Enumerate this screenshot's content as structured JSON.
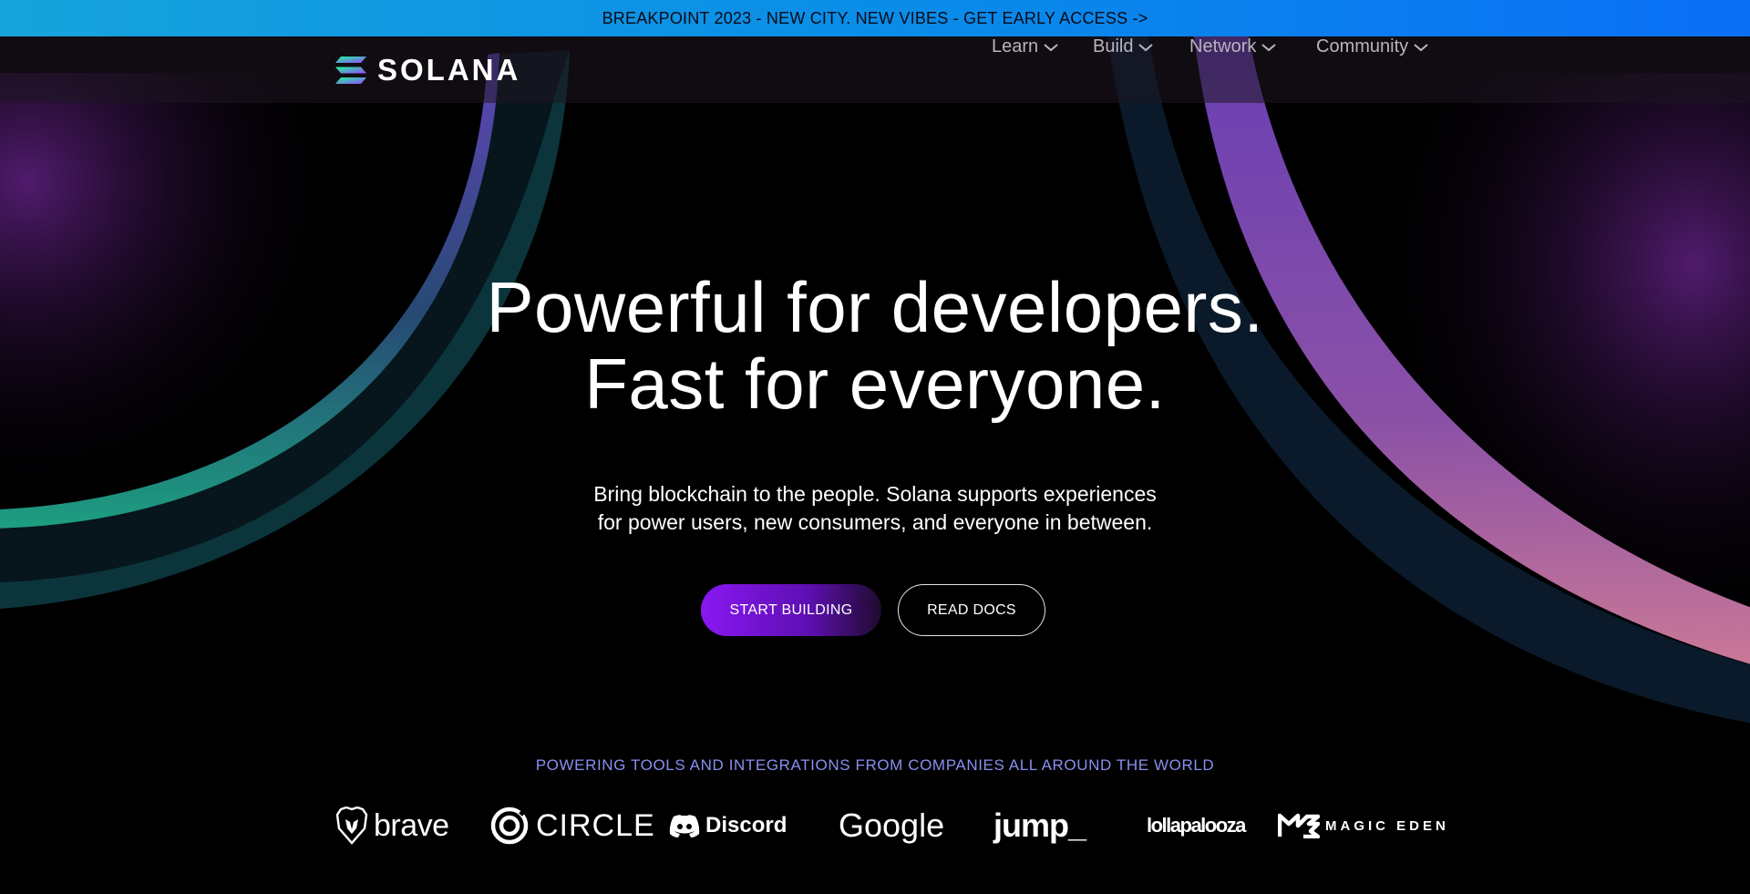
{
  "banner": {
    "text": "BREAKPOINT 2023 - NEW CITY. NEW VIBES - GET EARLY ACCESS ->"
  },
  "brand": {
    "name": "SOLANA",
    "icon": "solana-logo-icon"
  },
  "nav": {
    "items": [
      {
        "label": "Learn",
        "icon": "chevron-down-icon"
      },
      {
        "label": "Build",
        "icon": "chevron-down-icon"
      },
      {
        "label": "Network",
        "icon": "chevron-down-icon"
      },
      {
        "label": "Community",
        "icon": "chevron-down-icon"
      }
    ]
  },
  "hero": {
    "headline_line1": "Powerful for developers.",
    "headline_line2": "Fast for everyone.",
    "sub_line1": "Bring blockchain to the people. Solana supports experiences",
    "sub_line2": "for power users, new consumers, and everyone in between.",
    "primary_button": "START BUILDING",
    "secondary_button": "READ DOCS"
  },
  "partners": {
    "heading": "POWERING TOOLS AND INTEGRATIONS FROM COMPANIES ALL AROUND THE WORLD",
    "logos": [
      {
        "name": "brave",
        "icon": "brave-lion-icon"
      },
      {
        "name": "CIRCLE",
        "icon": "circle-logo-icon"
      },
      {
        "name": "Discord",
        "icon": "discord-icon"
      },
      {
        "name": "Google"
      },
      {
        "name": "jump_"
      },
      {
        "name": "lollapalooza"
      },
      {
        "name": "MAGIC EDEN",
        "icon": "magic-eden-icon"
      }
    ]
  },
  "colors": {
    "banner_start": "#17a4dc",
    "banner_end": "#0a6ff5",
    "primary_button": "#8a17f2",
    "powering_text": "#8a8ff0"
  }
}
